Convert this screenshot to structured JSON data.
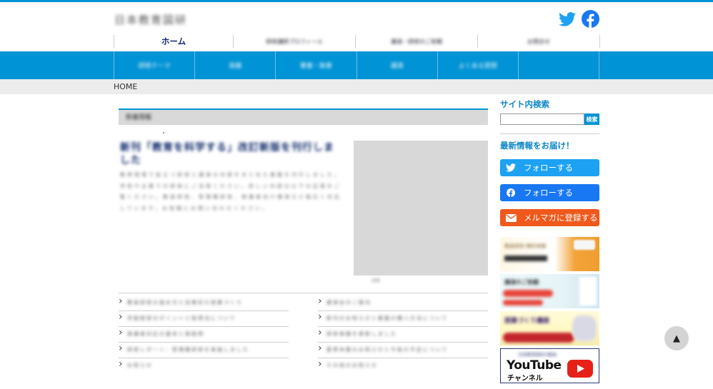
{
  "site": {
    "logo_text": "日本教育図研"
  },
  "nav": {
    "items": [
      "ホーム",
      "研修講師プロフィール",
      "講演・研修のご依頼",
      "お問合せ"
    ]
  },
  "subnav": {
    "items": [
      "研修テーマ",
      "実績",
      "著書・執筆",
      "講演",
      "よくある質問",
      ""
    ]
  },
  "breadcrumb": {
    "home": "HOME"
  },
  "article": {
    "section_label": "新着情報",
    "title": "新刊「教育を科学する」改訂新版を刊行しました",
    "body": "教育現場で役立つ研修と講演の内容をまとめた書籍を刊行しました。学校や企業での研修にご活用ください。詳しい内容は以下の記事をご覧ください。教員研修、管理職研修、保護者向け講演など幅広く対応しています。お気軽にお問い合わせください。",
    "image_caption": "画像"
  },
  "list_left": [
    "教員研修の進め方と効果的な授業づくり",
    "学級経営のポイントと指導法について",
    "保護者対応の基本と実践例",
    "研修レポート：管理職研修を実施しました",
    "お知らせ"
  ],
  "list_right": [
    "講演会のご案内",
    "新刊のお知らせと書籍の購入方法について",
    "研修実績を更新しました",
    "夏季休業のお知らせと今後の予定について",
    "その他のお知らせ"
  ],
  "sidebar": {
    "search_title": "サイト内検索",
    "search_button": "検索",
    "search_placeholder": "",
    "news_title": "最新情報をお届け！",
    "twitter_follow": "フォローする",
    "facebook_follow": "フォローする",
    "mail_subscribe": "メルマガに登録する",
    "banner1_text": "教員研修 無料体験",
    "banner2_text": "講演のご依頼",
    "banner3_text": "授業づくり講座",
    "youtube_title": "YouTube",
    "youtube_sub": "チャンネル",
    "youtube_top": "日本教育図研の動画"
  },
  "colors": {
    "brand_blue": "#0093d5",
    "twitter": "#1da1f2",
    "facebook": "#1877f2",
    "mail": "#f0581c",
    "youtube_red": "#e62117"
  },
  "icons": {
    "twitter": "twitter-icon",
    "facebook": "facebook-icon",
    "mail": "mail-icon",
    "pagetop": "triangle-up-icon"
  },
  "pagetop": {
    "label": "▲"
  }
}
